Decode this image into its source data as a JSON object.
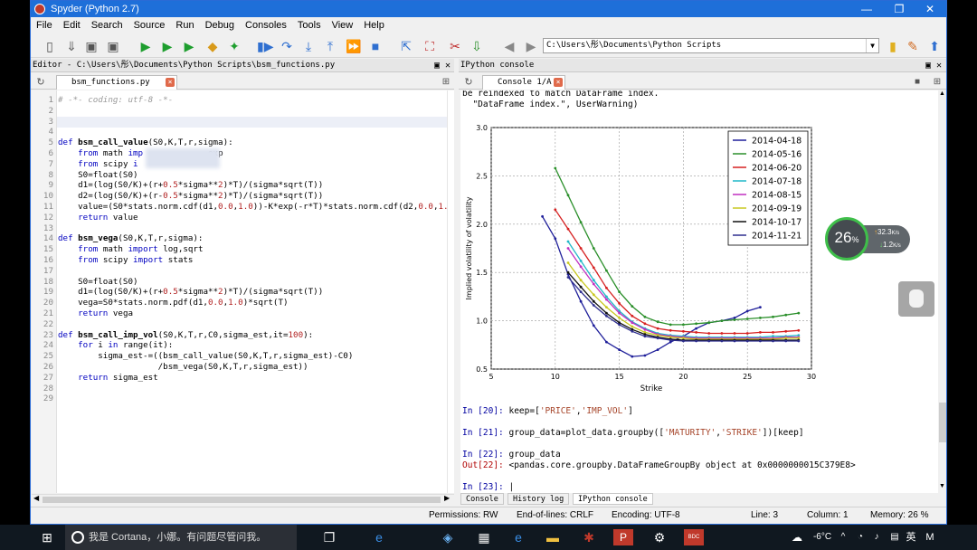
{
  "window": {
    "title": "Spyder (Python 2.7)",
    "minimize": "—",
    "restore": "❐",
    "close": "✕"
  },
  "menu": [
    "File",
    "Edit",
    "Search",
    "Source",
    "Run",
    "Debug",
    "Consoles",
    "Tools",
    "View",
    "Help"
  ],
  "toolbar": {
    "path": "C:\\Users\\彤\\Documents\\Python Scripts"
  },
  "editor": {
    "pane_title": "Editor - C:\\Users\\彤\\Documents\\Python Scripts\\bsm_functions.py",
    "tab": "bsm_functions.py",
    "lines": [
      {
        "n": "1",
        "html": "<span class='cm'># -*- coding: utf-8 -*-</span>"
      },
      {
        "n": "2",
        "html": ""
      },
      {
        "n": "3",
        "html": ""
      },
      {
        "n": "4",
        "html": ""
      },
      {
        "n": "5",
        "html": "<span class='kw'>def</span> <span class='fn'>bsm_call_value</span>(S0,K,T,r,sigma):"
      },
      {
        "n": "6",
        "html": "    <span class='kw'>from</span> math <span class='kw'>imp</span>            ,exp"
      },
      {
        "n": "7",
        "html": "    <span class='kw'>from</span> scipy <span class='kw'>i</span>"
      },
      {
        "n": "8",
        "html": "    S0=float(S0)"
      },
      {
        "n": "9",
        "html": "    d1=(log(S0/K)+(r+<span class='num'>0.5</span>*sigma**<span class='num'>2</span>)*T)/(sigma*sqrt(T))"
      },
      {
        "n": "10",
        "html": "    d2=(log(S0/K)+(r-<span class='num'>0.5</span>*sigma**<span class='num'>2</span>)*T)/(sigma*sqrt(T))"
      },
      {
        "n": "11",
        "html": "    value=(S0*stats.norm.cdf(d1,<span class='num'>0.0</span>,<span class='num'>1.0</span>))-K*exp(-r*T)*stats.norm.cdf(d2,<span class='num'>0.0</span>,<span class='num'>1.</span>"
      },
      {
        "n": "12",
        "html": "    <span class='kw'>return</span> value"
      },
      {
        "n": "13",
        "html": ""
      },
      {
        "n": "14",
        "html": "<span class='kw'>def</span> <span class='fn'>bsm_vega</span>(S0,K,T,r,sigma):"
      },
      {
        "n": "15",
        "html": "    <span class='kw'>from</span> math <span class='kw'>import</span> log,sqrt"
      },
      {
        "n": "16",
        "html": "    <span class='kw'>from</span> scipy <span class='kw'>import</span> stats"
      },
      {
        "n": "17",
        "html": ""
      },
      {
        "n": "18",
        "html": "    S0=float(S0)"
      },
      {
        "n": "19",
        "html": "    d1=(log(S0/K)+(r+<span class='num'>0.5</span>*sigma**<span class='num'>2</span>)*T)/(sigma*sqrt(T))"
      },
      {
        "n": "20",
        "html": "    vega=S0*stats.norm.pdf(d1,<span class='num'>0.0</span>,<span class='num'>1.0</span>)*sqrt(T)"
      },
      {
        "n": "21",
        "html": "    <span class='kw'>return</span> vega"
      },
      {
        "n": "22",
        "html": ""
      },
      {
        "n": "23",
        "html": "<span class='kw'>def</span> <span class='fn'>bsm_call_imp_vol</span>(S0,K,T,r,C0,sigma_est,it=<span class='num'>100</span>):"
      },
      {
        "n": "24",
        "html": "    <span class='kw'>for</span> i <span class='kw'>in</span> range(it):"
      },
      {
        "n": "25",
        "html": "        sigma_est-=((bsm_call_value(S0,K,T,r,sigma_est)-C0)"
      },
      {
        "n": "26",
        "html": "                    /bsm_vega(S0,K,T,r,sigma_est))"
      },
      {
        "n": "27",
        "html": "    <span class='kw'>return</span> sigma_est"
      },
      {
        "n": "28",
        "html": ""
      },
      {
        "n": "29",
        "html": ""
      }
    ]
  },
  "console": {
    "pane_title": "IPython console",
    "tab": "Console 1/A",
    "warn1": "be reindexed to match DataFrame index.",
    "warn2": "  \"DataFrame index.\", UserWarning)",
    "lines": [
      {
        "html": "<span class='in'>In [20]:</span> keep=[<span class='str'>'PRICE'</span>,<span class='str'>'IMP_VOL'</span>]"
      },
      {
        "html": "<span class='in'>In [21]:</span> group_data=plot_data.groupby([<span class='str'>'MATURITY'</span>,<span class='str'>'STRIKE'</span>])[keep]"
      },
      {
        "html": "<span class='in'>In [22]:</span> group_data"
      },
      {
        "html": "<span class='out'>Out[22]:</span> &lt;pandas.core.groupby.DataFrameGroupBy object at 0x0000000015C379E8&gt;"
      },
      {
        "html": "<span class='in'>In [23]:</span> |"
      }
    ],
    "bottom_tabs": [
      "Console",
      "History log",
      "IPython console"
    ]
  },
  "status": {
    "permissions": "Permissions: RW",
    "eol": "End-of-lines: CRLF",
    "encoding": "Encoding: UTF-8",
    "line": "Line: 3",
    "column": "Column: 1",
    "memory": "Memory: 26 %"
  },
  "widget": {
    "percent": "26",
    "unit": "%",
    "up": "32.3",
    "up_unit": "K/s",
    "down": "1.2",
    "down_unit": "K/s"
  },
  "taskbar": {
    "cortana": "我是 Cortana，小娜。有问题尽管问我。",
    "temp": "-6°C",
    "ime": "英",
    "ime2": "M",
    "app_label": "BDC"
  },
  "chart_data": {
    "type": "line",
    "xlabel": "Strike",
    "ylabel": "Implied volatility of volatility",
    "xlim": [
      5,
      30
    ],
    "ylim": [
      0.5,
      3.0
    ],
    "xticks": [
      "5",
      "10",
      "15",
      "20",
      "25",
      "30"
    ],
    "yticks": [
      "0.5",
      "1.0",
      "1.5",
      "2.0",
      "2.5",
      "3.0"
    ],
    "grid": true,
    "legend": "top-right",
    "series": [
      {
        "name": "2014-04-18",
        "color": "#1f1f9a",
        "points": [
          [
            9,
            2.08
          ],
          [
            10,
            1.85
          ],
          [
            11,
            1.48
          ],
          [
            12,
            1.2
          ],
          [
            13,
            0.95
          ],
          [
            14,
            0.78
          ],
          [
            15,
            0.7
          ],
          [
            16,
            0.63
          ],
          [
            17,
            0.64
          ],
          [
            18,
            0.7
          ],
          [
            19,
            0.78
          ],
          [
            20,
            0.84
          ],
          [
            21,
            0.92
          ],
          [
            22,
            0.98
          ],
          [
            23,
            1.0
          ],
          [
            24,
            1.03
          ],
          [
            25,
            1.1
          ],
          [
            26,
            1.14
          ]
        ]
      },
      {
        "name": "2014-05-16",
        "color": "#2a8f2a",
        "points": [
          [
            10,
            2.58
          ],
          [
            11,
            2.3
          ],
          [
            12,
            2.02
          ],
          [
            13,
            1.75
          ],
          [
            14,
            1.52
          ],
          [
            15,
            1.3
          ],
          [
            16,
            1.15
          ],
          [
            17,
            1.04
          ],
          [
            18,
            0.99
          ],
          [
            19,
            0.96
          ],
          [
            20,
            0.96
          ],
          [
            21,
            0.97
          ],
          [
            22,
            0.98
          ],
          [
            23,
            1.0
          ],
          [
            24,
            1.01
          ],
          [
            25,
            1.02
          ],
          [
            26,
            1.03
          ],
          [
            27,
            1.04
          ],
          [
            28,
            1.06
          ],
          [
            29,
            1.08
          ]
        ]
      },
      {
        "name": "2014-06-20",
        "color": "#d62020",
        "points": [
          [
            10,
            2.15
          ],
          [
            11,
            1.95
          ],
          [
            12,
            1.75
          ],
          [
            13,
            1.55
          ],
          [
            14,
            1.34
          ],
          [
            15,
            1.18
          ],
          [
            16,
            1.05
          ],
          [
            17,
            0.97
          ],
          [
            18,
            0.92
          ],
          [
            19,
            0.9
          ],
          [
            20,
            0.89
          ],
          [
            21,
            0.88
          ],
          [
            22,
            0.87
          ],
          [
            23,
            0.87
          ],
          [
            24,
            0.87
          ],
          [
            25,
            0.87
          ],
          [
            26,
            0.88
          ],
          [
            27,
            0.88
          ],
          [
            28,
            0.89
          ],
          [
            29,
            0.9
          ]
        ]
      },
      {
        "name": "2014-07-18",
        "color": "#20b8c8",
        "points": [
          [
            11,
            1.82
          ],
          [
            12,
            1.62
          ],
          [
            13,
            1.42
          ],
          [
            14,
            1.25
          ],
          [
            15,
            1.1
          ],
          [
            16,
            0.99
          ],
          [
            17,
            0.92
          ],
          [
            18,
            0.87
          ],
          [
            19,
            0.85
          ],
          [
            20,
            0.84
          ],
          [
            21,
            0.83
          ],
          [
            22,
            0.83
          ],
          [
            23,
            0.83
          ],
          [
            24,
            0.83
          ],
          [
            25,
            0.83
          ],
          [
            26,
            0.83
          ],
          [
            27,
            0.84
          ],
          [
            28,
            0.84
          ],
          [
            29,
            0.85
          ]
        ]
      },
      {
        "name": "2014-08-15",
        "color": "#c02fc0",
        "points": [
          [
            11,
            1.75
          ],
          [
            12,
            1.56
          ],
          [
            13,
            1.38
          ],
          [
            14,
            1.22
          ],
          [
            15,
            1.08
          ],
          [
            16,
            0.98
          ],
          [
            17,
            0.91
          ],
          [
            18,
            0.86
          ],
          [
            19,
            0.84
          ],
          [
            20,
            0.83
          ],
          [
            21,
            0.82
          ],
          [
            22,
            0.82
          ],
          [
            23,
            0.82
          ],
          [
            24,
            0.82
          ],
          [
            25,
            0.82
          ],
          [
            26,
            0.82
          ],
          [
            27,
            0.82
          ],
          [
            28,
            0.83
          ],
          [
            29,
            0.83
          ]
        ]
      },
      {
        "name": "2014-09-19",
        "color": "#c8c820",
        "points": [
          [
            11,
            1.6
          ],
          [
            12,
            1.42
          ],
          [
            13,
            1.27
          ],
          [
            14,
            1.14
          ],
          [
            15,
            1.03
          ],
          [
            16,
            0.94
          ],
          [
            17,
            0.88
          ],
          [
            18,
            0.85
          ],
          [
            19,
            0.83
          ],
          [
            20,
            0.82
          ],
          [
            21,
            0.81
          ],
          [
            22,
            0.81
          ],
          [
            23,
            0.81
          ],
          [
            24,
            0.81
          ],
          [
            25,
            0.81
          ],
          [
            26,
            0.81
          ],
          [
            27,
            0.81
          ],
          [
            28,
            0.82
          ],
          [
            29,
            0.82
          ]
        ]
      },
      {
        "name": "2014-10-17",
        "color": "#111111",
        "points": [
          [
            11,
            1.5
          ],
          [
            12,
            1.35
          ],
          [
            13,
            1.2
          ],
          [
            14,
            1.08
          ],
          [
            15,
            0.98
          ],
          [
            16,
            0.91
          ],
          [
            17,
            0.86
          ],
          [
            18,
            0.83
          ],
          [
            19,
            0.81
          ],
          [
            20,
            0.8
          ],
          [
            21,
            0.8
          ],
          [
            22,
            0.8
          ],
          [
            23,
            0.8
          ],
          [
            24,
            0.8
          ],
          [
            25,
            0.8
          ],
          [
            26,
            0.8
          ],
          [
            27,
            0.8
          ],
          [
            28,
            0.8
          ],
          [
            29,
            0.8
          ]
        ]
      },
      {
        "name": "2014-11-21",
        "color": "#2f2f8f",
        "points": [
          [
            11,
            1.45
          ],
          [
            12,
            1.3
          ],
          [
            13,
            1.16
          ],
          [
            14,
            1.05
          ],
          [
            15,
            0.96
          ],
          [
            16,
            0.89
          ],
          [
            17,
            0.84
          ],
          [
            18,
            0.82
          ],
          [
            19,
            0.8
          ],
          [
            20,
            0.79
          ],
          [
            21,
            0.79
          ],
          [
            22,
            0.79
          ],
          [
            23,
            0.79
          ],
          [
            24,
            0.79
          ],
          [
            25,
            0.79
          ],
          [
            26,
            0.79
          ],
          [
            27,
            0.79
          ],
          [
            28,
            0.79
          ],
          [
            29,
            0.79
          ]
        ]
      }
    ]
  }
}
